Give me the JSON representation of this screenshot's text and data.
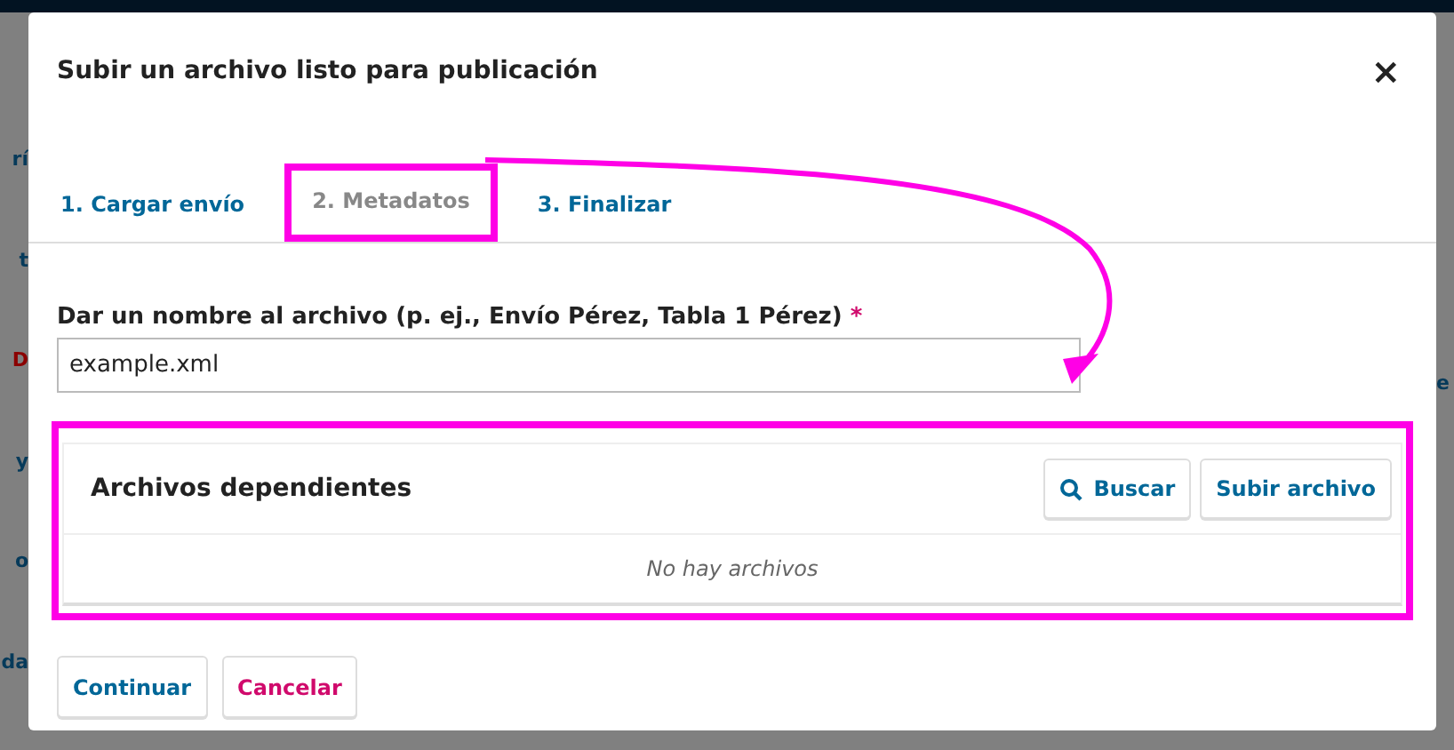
{
  "background_fragments": {
    "left": [
      {
        "text": "rí",
        "kind": "link"
      },
      {
        "text": "t",
        "kind": "link"
      },
      {
        "text": "D",
        "kind": "alert"
      },
      {
        "text": "y",
        "kind": "link"
      },
      {
        "text": "o",
        "kind": "link"
      },
      {
        "text": "da",
        "kind": "link"
      }
    ],
    "right": [
      {
        "text": "e"
      }
    ]
  },
  "dialog": {
    "title": "Subir un archivo listo para publicación",
    "close": "×",
    "tabs": [
      {
        "label": "1. Cargar envío",
        "selected": false,
        "highlighted": false
      },
      {
        "label": "2. Metadatos",
        "selected": true,
        "highlighted": true
      },
      {
        "label": "3. Finalizar",
        "selected": false,
        "highlighted": false
      }
    ],
    "name_field": {
      "label": "Dar un nombre al archivo (p. ej., Envío Pérez, Tabla 1 Pérez)",
      "required_mark": "*",
      "value": "example.xml"
    },
    "dependent_files": {
      "title": "Archivos dependientes",
      "highlighted": true,
      "buttons": [
        {
          "label": "Buscar",
          "kind": "search"
        },
        {
          "label": "Subir archivo",
          "kind": "plain"
        }
      ],
      "empty_text": "No hay archivos"
    },
    "annotation_arrow": true,
    "buttons": [
      {
        "label": "Continuar",
        "kind": "primary"
      },
      {
        "label": "Cancelar",
        "kind": "cancel"
      }
    ]
  }
}
